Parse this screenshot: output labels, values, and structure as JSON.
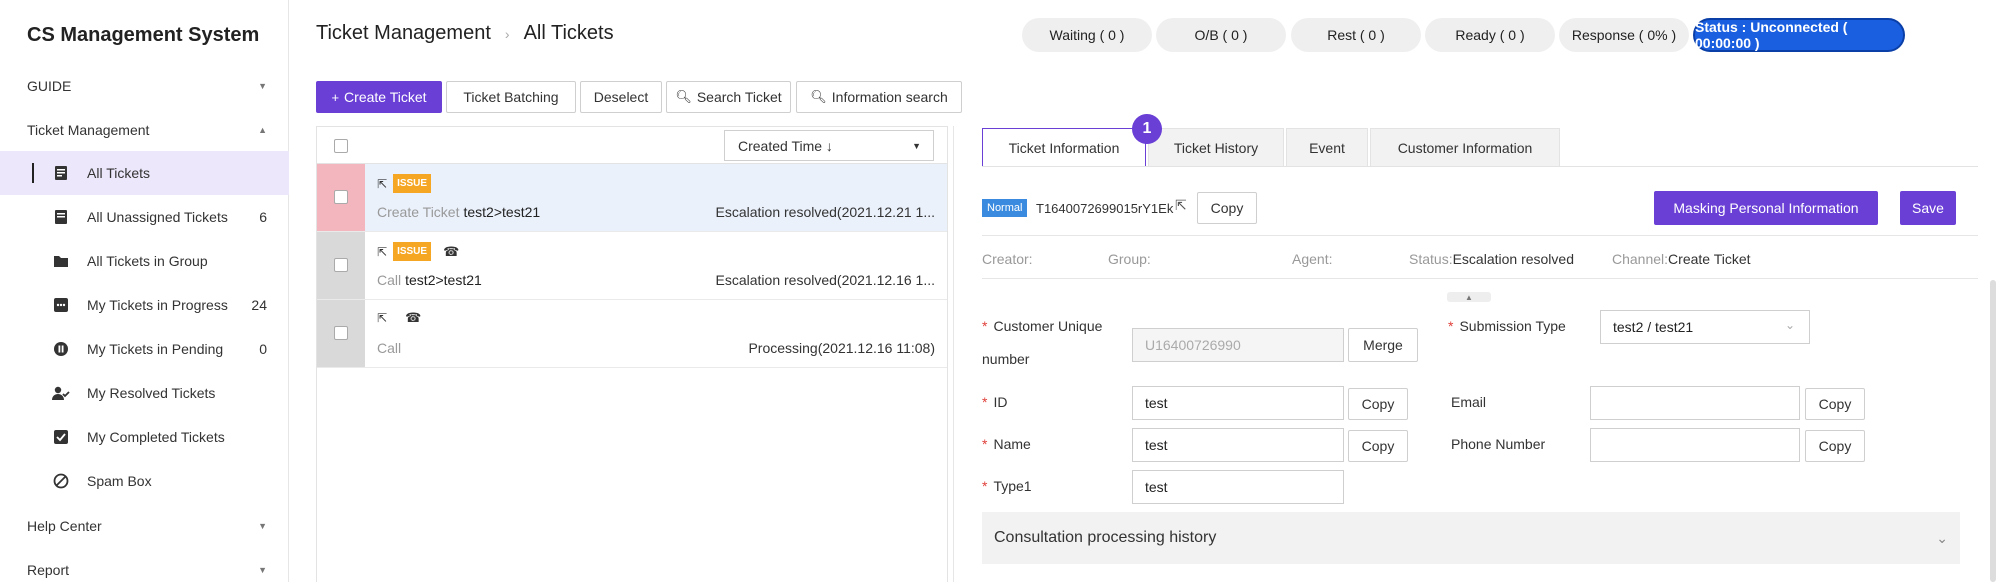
{
  "app": {
    "title": "CS Management System"
  },
  "sidebar": {
    "groups": [
      {
        "label": "GUIDE",
        "expanded": false
      },
      {
        "label": "Ticket Management",
        "expanded": true
      },
      {
        "label": "Help Center",
        "expanded": false
      },
      {
        "label": "Report",
        "expanded": false
      }
    ],
    "items": [
      {
        "label": "All Tickets",
        "count": "",
        "icon": "ticket-list-icon",
        "active": true
      },
      {
        "label": "All Unassigned Tickets",
        "count": "6",
        "icon": "ticket-icon"
      },
      {
        "label": "All Tickets in Group",
        "count": "",
        "icon": "folder-icon"
      },
      {
        "label": "My Tickets in Progress",
        "count": "24",
        "icon": "progress-icon"
      },
      {
        "label": "My Tickets in Pending",
        "count": "0",
        "icon": "pause-icon"
      },
      {
        "label": "My Resolved Tickets",
        "count": "",
        "icon": "user-check-icon"
      },
      {
        "label": "My Completed Tickets",
        "count": "",
        "icon": "checkbox-icon"
      },
      {
        "label": "Spam Box",
        "count": "",
        "icon": "block-icon"
      }
    ]
  },
  "header": {
    "breadcrumb": [
      "Ticket Management",
      "All Tickets"
    ],
    "status": {
      "waiting": "Waiting ( 0 )",
      "ob": "O/B ( 0 )",
      "rest": "Rest ( 0 )",
      "ready": "Ready ( 0 )",
      "response": "Response ( 0% )",
      "connection": "Status : Unconnected ( 00:00:00 )"
    }
  },
  "toolbar": {
    "create": "Create Ticket",
    "batching": "Ticket Batching",
    "deselect": "Deselect",
    "search": "Search Ticket",
    "info_search": "Information search"
  },
  "list": {
    "sort_label": "Created Time ↓",
    "rows": [
      {
        "badge": "ISSUE",
        "phone": false,
        "channel": "Create Ticket",
        "type": "test2>test21",
        "status": "Escalation resolved(2021.12.21 1...",
        "selected": true
      },
      {
        "badge": "ISSUE",
        "phone": true,
        "channel": "Call",
        "type": "test2>test21",
        "status": "Escalation resolved(2021.12.16 1...",
        "selected": false
      },
      {
        "badge": "",
        "phone": true,
        "channel": "Call",
        "type": "",
        "status": "Processing(2021.12.16 11:08)",
        "selected": false
      }
    ]
  },
  "detail": {
    "tabs": [
      "Ticket Information",
      "Ticket History",
      "Event",
      "Customer Information"
    ],
    "step": "1",
    "priority": "Normal",
    "ticket_id": "T1640072699015rY1Ek",
    "copy": "Copy",
    "masking": "Masking Personal Information",
    "save": "Save",
    "meta": {
      "creator_label": "Creator:",
      "creator": "",
      "group_label": "Group:",
      "group": "",
      "agent_label": "Agent:",
      "agent": "",
      "status_label": "Status:",
      "status": "Escalation resolved",
      "channel_label": "Channel:",
      "channel": "Create Ticket"
    },
    "form": {
      "unique_label_1": "Customer Unique",
      "unique_label_2": "number",
      "unique_value": "U16400726990",
      "merge": "Merge",
      "submission_label": "Submission Type",
      "submission_value": "test2 / test21",
      "id_label": "ID",
      "id_value": "test",
      "email_label": "Email",
      "email_value": "",
      "name_label": "Name",
      "name_value": "test",
      "phone_label": "Phone Number",
      "phone_value": "",
      "type1_label": "Type1",
      "type1_value": "test"
    },
    "accordion": "Consultation processing history"
  },
  "colors": {
    "primary": "#6a3fd6",
    "status_blue": "#1a5fe0",
    "issue_orange": "#f5a623",
    "normal_blue": "#3a8be0",
    "selected_bar": "#f4b6be"
  }
}
